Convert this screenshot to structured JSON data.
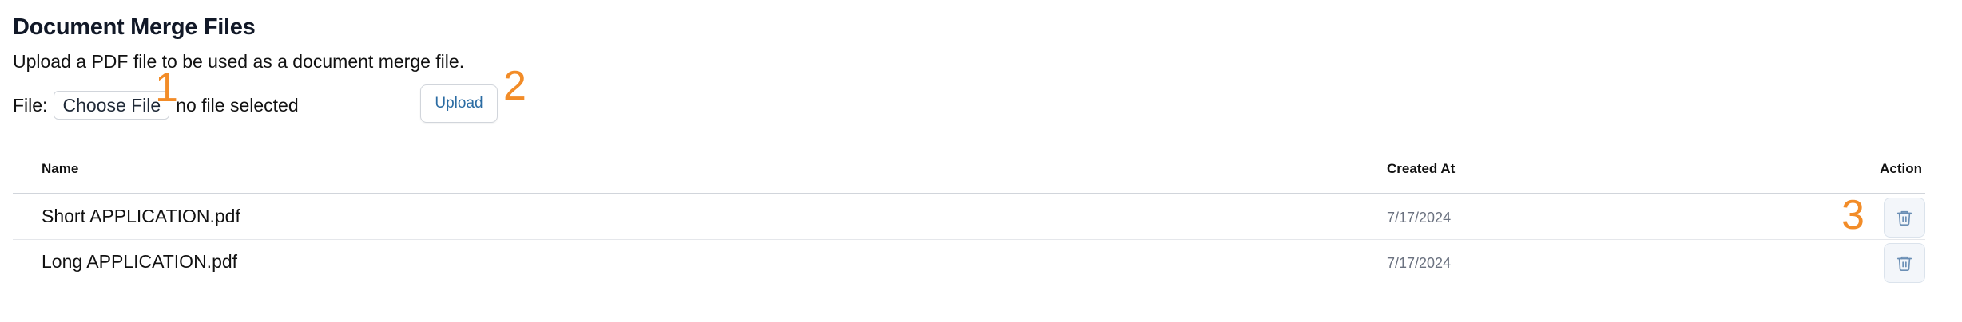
{
  "header": {
    "title": "Document Merge Files",
    "description": "Upload a PDF file to be used as a document merge file."
  },
  "file_input": {
    "label": "File:",
    "choose_label": "Choose File",
    "status": "no file selected"
  },
  "upload_button": {
    "label": "Upload"
  },
  "markers": [
    "1",
    "2",
    "3"
  ],
  "table": {
    "columns": {
      "name": "Name",
      "created_at": "Created At",
      "action": "Action"
    },
    "rows": [
      {
        "name": "Short APPLICATION.pdf",
        "created_at": "7/17/2024"
      },
      {
        "name": "Long APPLICATION.pdf",
        "created_at": "7/17/2024"
      }
    ]
  },
  "colors": {
    "accent_link": "#2b6ca3",
    "marker": "#f28c28",
    "title": "#111827",
    "muted": "#6b7280"
  },
  "icons": {
    "delete": "trash-icon"
  }
}
